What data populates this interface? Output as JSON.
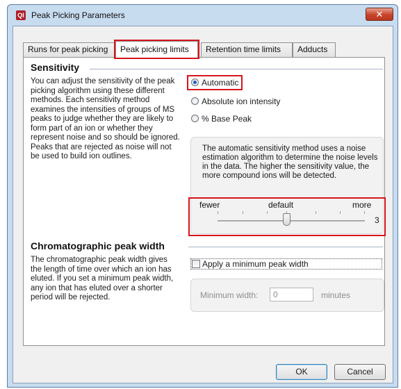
{
  "window": {
    "title": "Peak Picking Parameters",
    "app_icon_text": "QI",
    "close_glyph": "✕"
  },
  "tabs": [
    {
      "label": "Runs for peak picking",
      "active": false
    },
    {
      "label": "Peak picking limits",
      "active": true
    },
    {
      "label": "Retention time limits",
      "active": false
    },
    {
      "label": "Adducts",
      "active": false
    }
  ],
  "sensitivity": {
    "title": "Sensitivity",
    "description": "You can adjust the sensitivity of the peak picking algorithm using these different methods. Each sensitivity method examines the intensities of groups of MS peaks to judge whether they are likely to form part of an ion or whether they represent noise and so should be ignored. Peaks that are rejected as noise will not be used to build ion outlines.",
    "options": [
      {
        "label": "Automatic",
        "selected": true
      },
      {
        "label": "Absolute ion intensity",
        "selected": false
      },
      {
        "label": "% Base Peak",
        "selected": false
      }
    ],
    "info": "The automatic sensitivity method uses a noise estimation algorithm to determine the noise levels in the data. The higher the sensitivity value, the more compound ions will be detected.",
    "slider": {
      "min_label": "fewer",
      "mid_label": "default",
      "max_label": "more",
      "value": "3"
    }
  },
  "peak_width": {
    "title": "Chromatographic peak width",
    "description": "The chromatographic peak width gives the length of time over which an ion has eluted. If you set a minimum peak width, any ion that has eluted over a shorter period will be rejected.",
    "checkbox_label": "Apply a minimum peak width",
    "checkbox_checked": false,
    "min_width_label": "Minimum width:",
    "min_width_value": "0",
    "min_width_unit": "minutes"
  },
  "buttons": {
    "ok": "OK",
    "cancel": "Cancel"
  },
  "colors": {
    "highlight": "#d7141b",
    "titlebar": "#c8dcf0",
    "close_button": "#c7442b"
  }
}
